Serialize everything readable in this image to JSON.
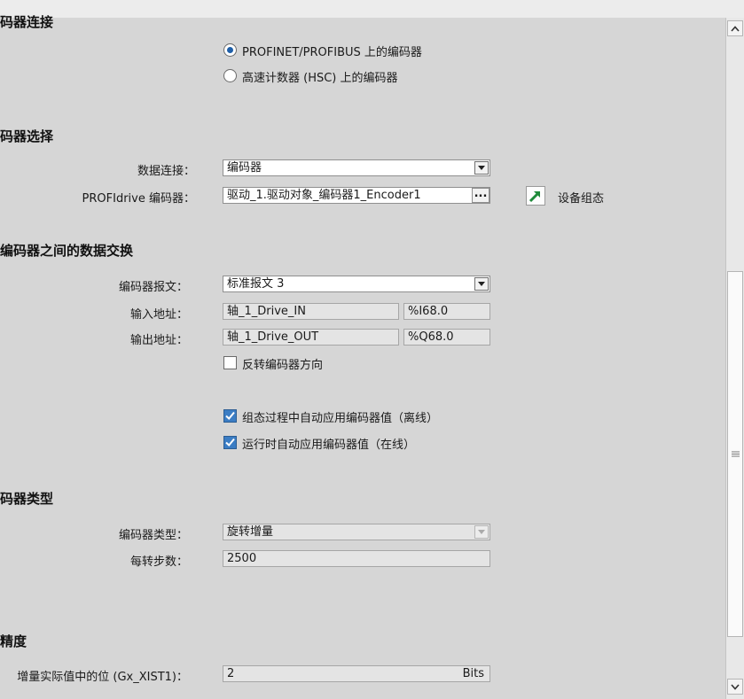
{
  "sections": {
    "connection_heading": "码器连接",
    "selection_heading": "码器选择",
    "exchange_heading": "编码器之间的数据交换",
    "type_heading": "码器类型",
    "precision_heading": "精度"
  },
  "connection": {
    "radio_profinet": "PROFINET/PROFIBUS 上的编码器",
    "radio_hsc": "高速计数器 (HSC) 上的编码器",
    "selected": "profinet"
  },
  "selection": {
    "data_link_label": "数据连接：",
    "data_link_value": "编码器",
    "profidrive_label": "PROFIdrive 编码器：",
    "profidrive_value": "驱动_1.驱动对象_编码器1_Encoder1",
    "ellipsis": "...",
    "device_config_label": "设备组态",
    "device_config_icon": "arrow-up-right-icon"
  },
  "exchange": {
    "telegram_label": "编码器报文：",
    "telegram_value": "标准报文 3",
    "input_label": "输入地址：",
    "input_tag": "轴_1_Drive_IN",
    "input_addr": "%I68.0",
    "output_label": "输出地址：",
    "output_tag": "轴_1_Drive_OUT",
    "output_addr": "%Q68.0",
    "invert_label": "反转编码器方向",
    "invert_checked": false,
    "auto_offline_label": "组态过程中自动应用编码器值（离线）",
    "auto_offline_checked": true,
    "auto_online_label": "运行时自动应用编码器值（在线）",
    "auto_online_checked": true
  },
  "encoder_type": {
    "type_label": "编码器类型：",
    "type_value": "旋转增量",
    "steps_label": "每转步数：",
    "steps_value": "2500"
  },
  "precision": {
    "bits_label": "增量实际值中的位 (Gx_XIST1)：",
    "bits_value": "2",
    "bits_unit": "Bits"
  },
  "scrollbar": {
    "up_icon": "chevron-up-icon",
    "down_icon": "chevron-down-icon",
    "grip_icon": "grip-icon"
  },
  "colors": {
    "accent": "#1f5fa8",
    "checkbox": "#3b7dc4",
    "device_icon": "#1e8a3a",
    "panel_bg": "#d6d6d6"
  }
}
